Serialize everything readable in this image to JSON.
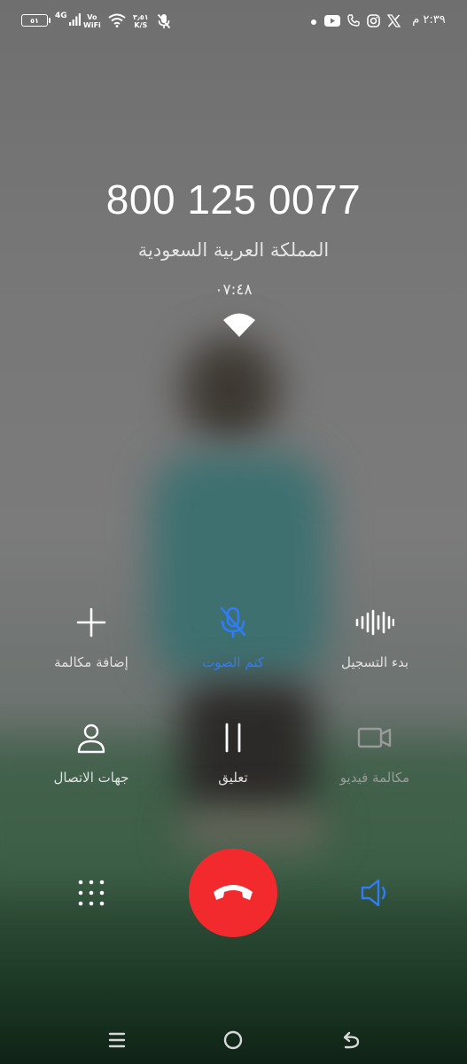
{
  "status_bar": {
    "battery": "٥١",
    "network_type": "4G",
    "vowifi_top": "Vo",
    "vowifi_bottom": "WiFi",
    "speed_value": "٣٫٥١",
    "speed_unit": "K/S",
    "time": "٢:٣٩ م",
    "icons": [
      "battery-icon",
      "signal-icon",
      "vowifi-icon",
      "wifi-icon",
      "mic-off-icon",
      "dot-icon",
      "youtube-icon",
      "phone-icon",
      "instagram-icon",
      "x-icon"
    ]
  },
  "call": {
    "number": "800 125 0077",
    "country": "المملكة العربية السعودية",
    "duration": "٠٧:٤٨"
  },
  "controls": {
    "add_call": "إضافة مكالمة",
    "mute": "كتم الصوت",
    "record": "بدء التسجيل",
    "contacts": "جهات الاتصال",
    "hold": "تعليق",
    "video_call": "مكالمة فيديو"
  },
  "colors": {
    "accent": "#2f7cf6",
    "end_call": "#f22a2e",
    "text": "#ffffff"
  }
}
